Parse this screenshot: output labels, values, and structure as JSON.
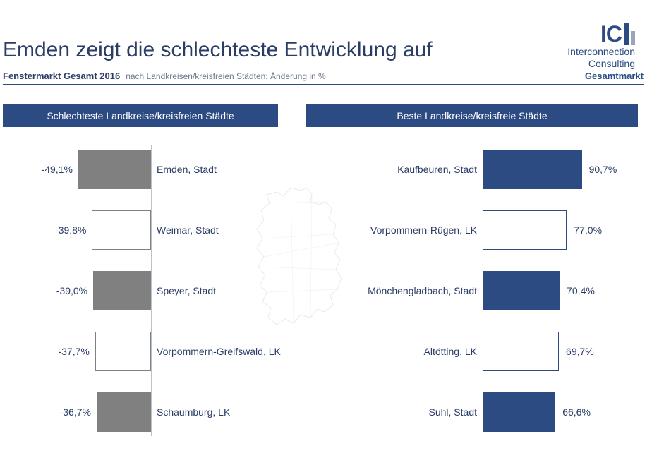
{
  "header": {
    "logo": {
      "ic": "IC",
      "line1": "Interconnection",
      "line2": "Consulting"
    },
    "title": "Emden zeigt die schlechteste Entwicklung auf",
    "sub_bold": "Fenstermarkt Gesamt 2016",
    "sub_note": "nach Landkreisen/kreisfreien Städten; Änderung in %",
    "sub_right": "Gesamtmarkt"
  },
  "columns": {
    "left_title": "Schlechteste Landkreise/kreisfreien Städte",
    "right_title": "Beste Landkreise/kreisfreie Städte"
  },
  "chart_data": [
    {
      "type": "bar",
      "title": "Schlechteste Landkreise/kreisfreien Städte",
      "orientation": "horizontal",
      "xlabel": "Änderung in %",
      "ylabel": "",
      "xlim": [
        -50,
        0
      ],
      "series": [
        {
          "name": "Änderung %",
          "categories": [
            "Emden, Stadt",
            "Weimar, Stadt",
            "Speyer, Stadt",
            "Vorpommern-Greifswald, LK",
            "Schaumburg, LK"
          ],
          "values": [
            -49.1,
            -39.8,
            -39.0,
            -37.7,
            -36.7
          ]
        }
      ]
    },
    {
      "type": "bar",
      "title": "Beste Landkreise/kreisfreie Städte",
      "orientation": "horizontal",
      "xlabel": "Änderung in %",
      "ylabel": "",
      "xlim": [
        0,
        100
      ],
      "series": [
        {
          "name": "Änderung %",
          "categories": [
            "Kaufbeuren, Stadt",
            "Vorpommern-Rügen, LK",
            "Mönchengladbach, Stadt",
            "Altötting, LK",
            "Suhl, Stadt"
          ],
          "values": [
            90.7,
            77.0,
            70.4,
            69.7,
            66.6
          ]
        }
      ]
    }
  ],
  "worst": {
    "items": [
      {
        "label": "Emden, Stadt",
        "value_text": "-49,1%",
        "value": -49.1,
        "fill": "solid"
      },
      {
        "label": "Weimar, Stadt",
        "value_text": "-39,8%",
        "value": -39.8,
        "fill": "outline"
      },
      {
        "label": "Speyer, Stadt",
        "value_text": "-39,0%",
        "value": -39.0,
        "fill": "solid"
      },
      {
        "label": "Vorpommern-Greifswald, LK",
        "value_text": "-37,7%",
        "value": -37.7,
        "fill": "outline"
      },
      {
        "label": "Schaumburg, LK",
        "value_text": "-36,7%",
        "value": -36.7,
        "fill": "solid"
      }
    ]
  },
  "best": {
    "items": [
      {
        "label": "Kaufbeuren, Stadt",
        "value_text": "90,7%",
        "value": 90.7,
        "fill": "solid"
      },
      {
        "label": "Vorpommern-Rügen, LK",
        "value_text": "77,0%",
        "value": 77.0,
        "fill": "outline"
      },
      {
        "label": "Mönchengladbach, Stadt",
        "value_text": "70,4%",
        "value": 70.4,
        "fill": "solid"
      },
      {
        "label": "Altötting, LK",
        "value_text": "69,7%",
        "value": 69.7,
        "fill": "outline"
      },
      {
        "label": "Suhl, Stadt",
        "value_text": "66,6%",
        "value": 66.6,
        "fill": "solid"
      }
    ]
  },
  "colors": {
    "blue": "#2b4b82",
    "grey": "#808080"
  }
}
